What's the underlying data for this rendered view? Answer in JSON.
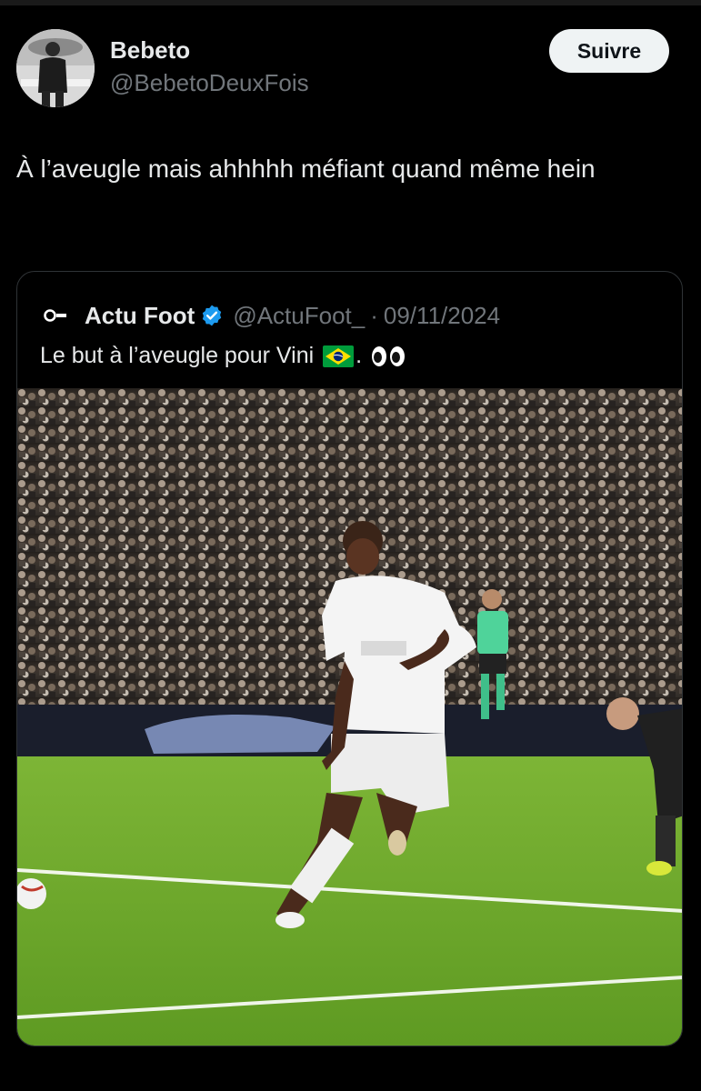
{
  "tweet": {
    "author_name": "Bebeto",
    "author_handle": "@BebetoDeuxFois",
    "follow_label": "Suivre",
    "text": "À l’aveugle mais ahhhhh méfiant quand même hein"
  },
  "quoted": {
    "author_name": "Actu Foot",
    "author_handle": "@ActuFoot_",
    "separator": "·",
    "date": "09/11/2024",
    "text": "Le but à l’aveugle pour Vini",
    "text_suffix": "."
  },
  "icons": {
    "verified": "verified-badge-icon",
    "flag": "brazil-flag-icon",
    "eyes": "eyes-emoji-icon"
  },
  "colors": {
    "background": "#000000",
    "text_primary": "#e7e9ea",
    "text_secondary": "#71767b",
    "follow_button_bg": "#eff3f4",
    "verified_blue": "#1d9bf0",
    "card_border": "#2f3336"
  }
}
